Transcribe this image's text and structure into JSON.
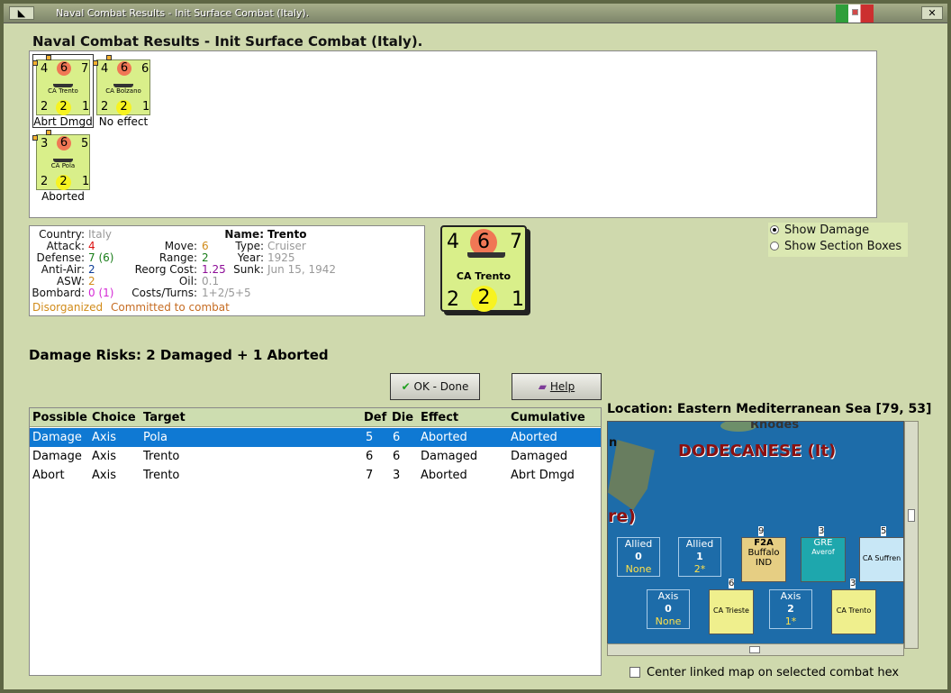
{
  "window": {
    "title": "Naval Combat Results - Init Surface Combat (Italy).",
    "heading": "Naval Combat Results - Init Surface Combat (Italy)."
  },
  "cards": [
    {
      "atk": "4",
      "def": "6",
      "mv": "7",
      "name": "CA Trento",
      "aa": "2",
      "asw": "2",
      "bomb": "1",
      "result": "Abrt Dmgd"
    },
    {
      "atk": "4",
      "def": "6",
      "mv": "6",
      "name": "CA Bolzano",
      "aa": "2",
      "asw": "2",
      "bomb": "1",
      "result": "No effect"
    },
    {
      "atk": "3",
      "def": "6",
      "mv": "5",
      "name": "CA Pola",
      "aa": "2",
      "asw": "2",
      "bomb": "1",
      "result": "Aborted"
    }
  ],
  "info": {
    "country_l": "Country:",
    "country": "Italy",
    "attack_l": "Attack:",
    "attack": "4",
    "defense_l": "Defense:",
    "defense": "7 (6)",
    "antiair_l": "Anti-Air:",
    "antiair": "2",
    "asw_l": "ASW:",
    "asw": "2",
    "bombard_l": "Bombard:",
    "bombard": "0 (1)",
    "move_l": "Move:",
    "move": "6",
    "range_l": "Range:",
    "range": "2",
    "reorg_l": "Reorg Cost:",
    "reorg": "1.25",
    "oil_l": "Oil:",
    "oil": "0.1",
    "costs_l": "Costs/Turns:",
    "costs": "1+2/5+5",
    "name_l": "Name:",
    "name": "Trento",
    "type_l": "Type:",
    "type": "Cruiser",
    "year_l": "Year:",
    "year": "1925",
    "sunk_l": "Sunk:",
    "sunk": "Jun 15, 1942",
    "status1": "Disorganized",
    "status2": "Committed to combat"
  },
  "bigcard": {
    "atk": "4",
    "def": "6",
    "mv": "7",
    "name": "CA Trento",
    "aa": "2",
    "asw": "2",
    "bomb": "1"
  },
  "radios": {
    "show_damage": "Show Damage",
    "show_section": "Show Section Boxes"
  },
  "damage": "Damage Risks:  2 Damaged + 1 Aborted",
  "buttons": {
    "ok": "OK - Done",
    "help": "Help"
  },
  "location": "Location:  Eastern Mediterranean Sea [79, 53]",
  "table": {
    "headers": [
      "Possible",
      "Choice",
      "Target",
      "Def",
      "Die",
      "Effect",
      "Cumulative"
    ],
    "rows": [
      [
        "Damage",
        "Axis",
        "Pola",
        "5",
        "6",
        "Aborted",
        "Aborted"
      ],
      [
        "Damage",
        "Axis",
        "Trento",
        "6",
        "6",
        "Damaged",
        "Damaged"
      ],
      [
        "Abort",
        "Axis",
        "Trento",
        "7",
        "3",
        "Aborted",
        "Abrt Dmgd"
      ]
    ]
  },
  "map": {
    "title": "DODECANESE (It)",
    "island": "Rhodes",
    "partial": "n",
    "re": "re)",
    "allied1": [
      "Allied",
      "0",
      "None"
    ],
    "allied2": [
      "Allied",
      "1",
      "2*"
    ],
    "axis1": [
      "Axis",
      "0",
      "None"
    ],
    "axis2": [
      "Axis",
      "2",
      "1*"
    ],
    "f2a": "F2A",
    "buffalo": "Buffalo",
    "ind": "IND",
    "gre": "GRE",
    "averof": "Averof",
    "suffren": "CA Suffren",
    "trieste": "CA Trieste",
    "trento": "CA Trento",
    "s9": "9",
    "s3a": "3",
    "s5": "5",
    "s6": "6",
    "s3b": "3"
  },
  "checkbox": "Center linked map on selected combat hex"
}
